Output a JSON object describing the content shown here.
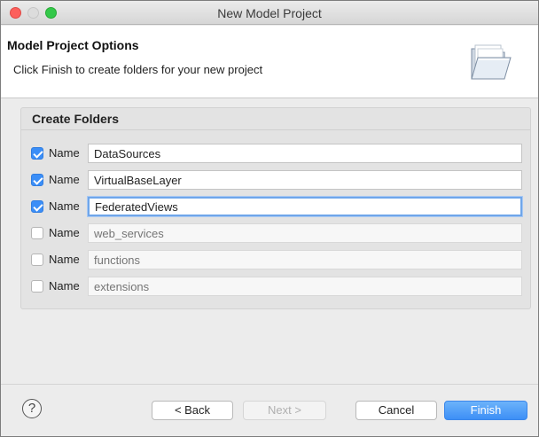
{
  "window": {
    "title": "New Model Project"
  },
  "header": {
    "title": "Model Project Options",
    "description": "Click Finish to create folders for your new project"
  },
  "group": {
    "title": "Create Folders",
    "rows": [
      {
        "label": "Name",
        "value": "DataSources",
        "placeholder": "",
        "checked": true
      },
      {
        "label": "Name",
        "value": "VirtualBaseLayer",
        "placeholder": "",
        "checked": true
      },
      {
        "label": "Name",
        "value": "FederatedViews",
        "placeholder": "",
        "checked": true
      },
      {
        "label": "Name",
        "value": "",
        "placeholder": "web_services",
        "checked": false
      },
      {
        "label": "Name",
        "value": "",
        "placeholder": "functions",
        "checked": false
      },
      {
        "label": "Name",
        "value": "",
        "placeholder": "extensions",
        "checked": false
      }
    ]
  },
  "footer": {
    "help_icon": "?",
    "back_label": "< Back",
    "next_label": "Next >",
    "cancel_label": "Cancel",
    "finish_label": "Finish"
  },
  "colors": {
    "accent": "#3b8ef7",
    "finish": "#4a98f7"
  }
}
